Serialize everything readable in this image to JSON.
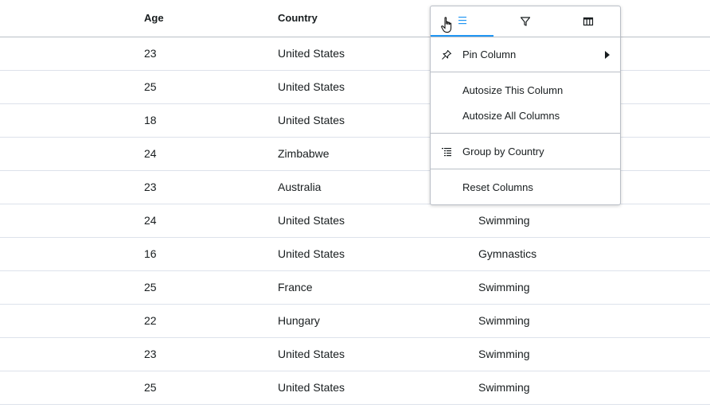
{
  "headers": {
    "age": "Age",
    "country": "Country"
  },
  "rows": [
    {
      "age": "23",
      "country": "United States",
      "sport": ""
    },
    {
      "age": "25",
      "country": "United States",
      "sport": ""
    },
    {
      "age": "18",
      "country": "United States",
      "sport": ""
    },
    {
      "age": "24",
      "country": "Zimbabwe",
      "sport": ""
    },
    {
      "age": "23",
      "country": "Australia",
      "sport": ""
    },
    {
      "age": "24",
      "country": "United States",
      "sport": "Swimming"
    },
    {
      "age": "16",
      "country": "United States",
      "sport": "Gymnastics"
    },
    {
      "age": "25",
      "country": "France",
      "sport": "Swimming"
    },
    {
      "age": "22",
      "country": "Hungary",
      "sport": "Swimming"
    },
    {
      "age": "23",
      "country": "United States",
      "sport": "Swimming"
    },
    {
      "age": "25",
      "country": "United States",
      "sport": "Swimming"
    }
  ],
  "menu": {
    "tabs": [
      {
        "icon": "menu-icon",
        "active": true
      },
      {
        "icon": "filter-icon",
        "active": false
      },
      {
        "icon": "columns-icon",
        "active": false
      }
    ],
    "items": {
      "pin_column": "Pin Column",
      "autosize_this": "Autosize This Column",
      "autosize_all": "Autosize All Columns",
      "group_by": "Group by Country",
      "reset_columns": "Reset Columns"
    }
  },
  "colors": {
    "accent": "#2196f3",
    "border": "#babfc7",
    "row_border": "#dde2eb",
    "text": "#181d1f"
  }
}
